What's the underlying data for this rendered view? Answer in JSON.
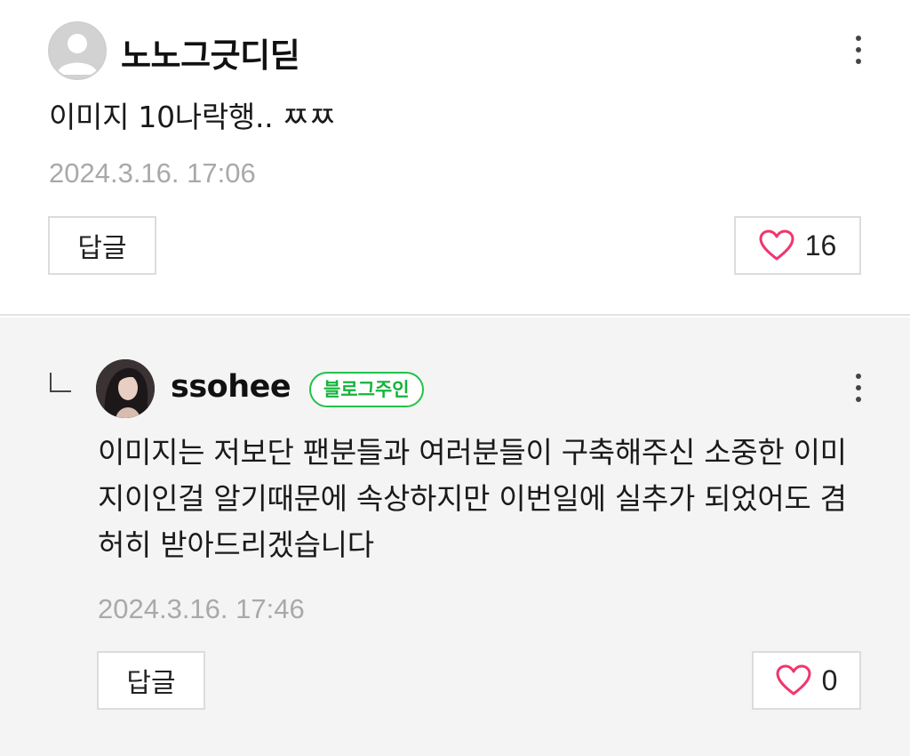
{
  "comments": [
    {
      "author": "노노그긋디딛",
      "text": "이미지 10나락행.. ㅉㅉ",
      "date": "2024.3.16. 17:06",
      "reply_label": "답글",
      "likes": "16"
    },
    {
      "author": "ssohee",
      "badge": "블로그주인",
      "text": "이미지는 저보단 팬분들과 여러분들이 구축해주신 소중한 이미지이인걸 알기때문에 속상하지만 이번일에 실추가 되었어도 겸허히 받아드리겠습니다",
      "date": "2024.3.16. 17:46",
      "reply_label": "답글",
      "likes": "0"
    }
  ],
  "colors": {
    "like_heart": "#f0366e",
    "owner_badge": "#22c24a",
    "reply_background": "#f4f4f4"
  },
  "icons": {
    "more": "more-vertical-icon",
    "like": "heart-outline-icon",
    "reply_indicator": "reply-arrow-icon",
    "default_avatar": "default-user-icon"
  }
}
